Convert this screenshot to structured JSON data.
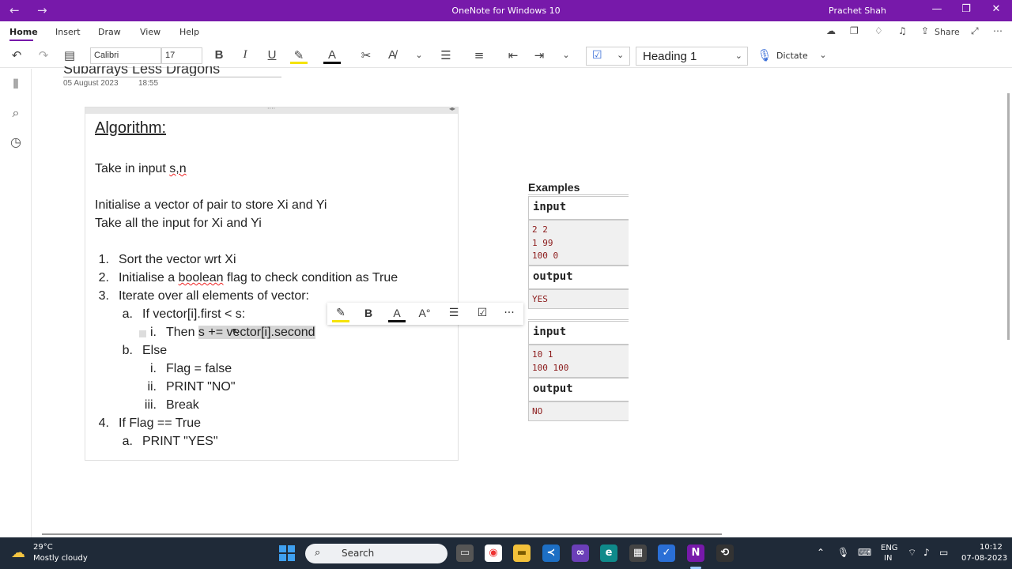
{
  "window": {
    "title": "OneNote for Windows 10",
    "user": "Prachet Shah",
    "back_glyph": "←",
    "forward_glyph": "→",
    "minimize_glyph": "—",
    "maximize_glyph": "❐",
    "close_glyph": "✕"
  },
  "tabs": [
    "Home",
    "Insert",
    "Draw",
    "View",
    "Help"
  ],
  "share_label": "Share",
  "ribbon": {
    "font_name": "Calibri",
    "font_size": "17",
    "bold": "B",
    "italic": "I",
    "underline": "U",
    "style": "Heading 1",
    "dictate": "Dictate",
    "accent_color": "#7719aa"
  },
  "page": {
    "title_fragment": "Subarrays Less Dragons",
    "date": "05 August 2023",
    "time": "18:55"
  },
  "note": {
    "heading": "Algorithm:",
    "line_input_prefix": "Take in input ",
    "line_input_vars": "s,n",
    "line_init": "Initialise a vector of pair to store Xi and Yi",
    "line_take": "Take all the input for Xi and Yi",
    "items": [
      {
        "num": "1.",
        "text": "Sort the vector wrt Xi"
      },
      {
        "num": "2.",
        "text": "Initialise a boolean flag to check condition as True"
      },
      {
        "num": "3.",
        "text": "Iterate over all elements of vector:"
      },
      {
        "num": "a.",
        "text": "If vector[i].first < s:"
      },
      {
        "num": "i.",
        "text_plain": "Then ",
        "text_selected": "s += vector[i].second"
      },
      {
        "num": "b.",
        "text": "Else"
      },
      {
        "num": "i.",
        "text": "Flag = false"
      },
      {
        "num": "ii.",
        "text": "PRINT \"NO\""
      },
      {
        "num": "iii.",
        "text": "Break"
      },
      {
        "num": "4.",
        "text": "If Flag == True"
      },
      {
        "num": "a.",
        "text": "PRINT \"YES\""
      }
    ]
  },
  "minibar": {
    "bold": "B",
    "more": "···"
  },
  "examples": {
    "heading": "Examples",
    "ex1": {
      "input_label": "input",
      "input_lines": [
        "2 2",
        "1 99",
        "100 0"
      ],
      "output_label": "output",
      "output_lines": [
        "YES"
      ]
    },
    "ex2": {
      "input_label": "input",
      "input_lines": [
        "10 1",
        "100 100"
      ],
      "output_label": "output",
      "output_lines": [
        "NO"
      ]
    }
  },
  "taskbar": {
    "temperature": "29°C",
    "weather": "Mostly cloudy",
    "search_placeholder": "Search",
    "lang1": "ENG",
    "lang2": "IN",
    "time": "10:12",
    "date": "07-08-2023"
  }
}
